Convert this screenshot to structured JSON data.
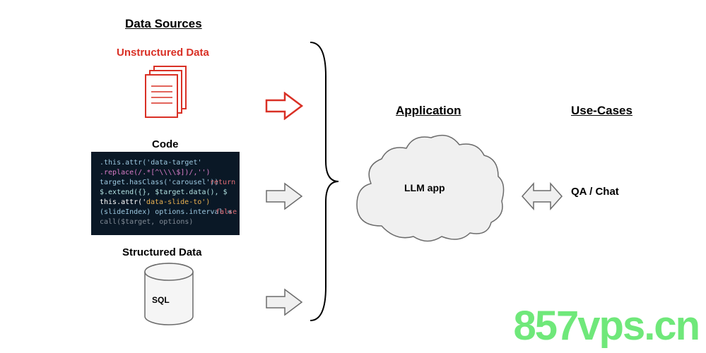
{
  "headers": {
    "data_sources": "Data Sources",
    "application": "Application",
    "use_cases": "Use-Cases"
  },
  "sources": {
    "unstructured": "Unstructured Data",
    "code": "Code",
    "structured": "Structured Data",
    "sql": "SQL"
  },
  "app": {
    "name": "LLM app"
  },
  "usecase": {
    "qa": "QA / Chat"
  },
  "watermark": "857vps.cn",
  "colors": {
    "red": "#d93025",
    "gray_fill": "#f0f0f0",
    "gray_stroke": "#6b6b6b",
    "code_bg": "#0a1826"
  }
}
